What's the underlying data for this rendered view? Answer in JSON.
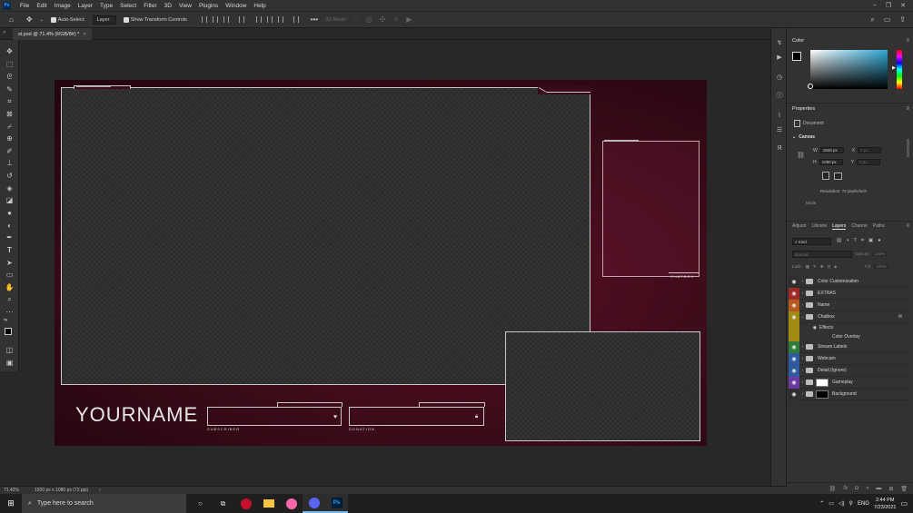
{
  "menubar": {
    "logo": "Ps",
    "items": [
      "File",
      "Edit",
      "Image",
      "Layer",
      "Type",
      "Select",
      "Filter",
      "3D",
      "View",
      "Plugins",
      "Window",
      "Help"
    ],
    "window_controls": [
      "–",
      "❐",
      "✕"
    ]
  },
  "options": {
    "auto_select_label": "Auto-Select:",
    "auto_select_value": "Layer",
    "transform_label": "Show Transform Controls",
    "more": "•••",
    "mode_3d": "3D Mode:"
  },
  "doc_tab": {
    "title": "st.psd @ 71.4% (RGB/8#) *",
    "close": "×"
  },
  "document": {
    "name_text": "YOURNAME",
    "subscriber_label": "SUBSCRIBER",
    "donation_label": "DONATION",
    "chatbox_label": "CHATBOX"
  },
  "color_panel": {
    "title": "Color",
    "fg_color": "#000000",
    "bg_color": "#ffffff",
    "field_hue": "#2ea7d6"
  },
  "properties": {
    "title": "Properties",
    "doc_label": "Document",
    "canvas_label": "Canvas",
    "w_label": "W",
    "w_value": "1920 px",
    "h_label": "H",
    "h_value": "1080 px",
    "x_label": "X",
    "x_value": "0 px",
    "y_label": "Y",
    "y_value": "0 px",
    "resolution": "Resolution: 72 pixels/inch",
    "mode_label": "Mode"
  },
  "layers_panel": {
    "tabs": [
      "Adjustr",
      "Librarie",
      "Layers",
      "Channe",
      "Paths"
    ],
    "active_tab": "Layers",
    "kind_label": "Kind",
    "blend_mode": "Normal",
    "opacity_label": "Opacity:",
    "opacity_value": "100%",
    "lock_label": "Lock:",
    "fill_label": "Fill:",
    "fill_value": "100%",
    "layers": [
      {
        "name": "Color Customization",
        "eye_color": "#2e2e2e",
        "type": "folder"
      },
      {
        "name": "EXTRAS",
        "eye_color": "#a02a2a",
        "type": "folder"
      },
      {
        "name": "Name",
        "eye_color": "#b5591f",
        "type": "folder"
      },
      {
        "name": "Chatbox",
        "eye_color": "#a08a12",
        "type": "folder",
        "fx": "fx"
      },
      {
        "name": "Effects",
        "eye_color": "#a08a12",
        "type": "effects"
      },
      {
        "name": "Color Overlay",
        "eye_color": "#a08a12",
        "type": "effect"
      },
      {
        "name": "Stream Labels",
        "eye_color": "#2e7d3a",
        "type": "folder"
      },
      {
        "name": "Webcam",
        "eye_color": "#2e5aa0",
        "type": "folder"
      },
      {
        "name": "Detail (Ignore)",
        "eye_color": "#2e5aa0",
        "type": "folder"
      },
      {
        "name": "Gameplay",
        "eye_color": "#6a3aa0",
        "type": "layer",
        "thumb": "#ffffff"
      },
      {
        "name": "Background",
        "eye_color": "#2e2e2e",
        "type": "layer",
        "thumb": "#000000"
      }
    ]
  },
  "status": {
    "zoom": "71.42%",
    "doc_size": "1920 px x 1080 px (72 ppi)",
    "arrow": "›"
  },
  "taskbar": {
    "search_placeholder": "Type here to search",
    "time": "2:44 PM",
    "date": "7/23/2021",
    "lang": "ENG"
  }
}
